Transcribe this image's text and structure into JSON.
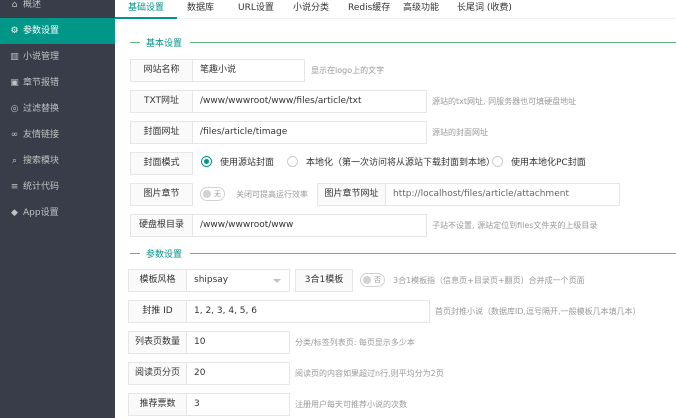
{
  "sidebar": {
    "items": [
      {
        "label": "概述",
        "icon": "home-icon"
      },
      {
        "label": "参数设置",
        "icon": "gear-icon"
      },
      {
        "label": "小说管理",
        "icon": "book-icon"
      },
      {
        "label": "章节报错",
        "icon": "report-icon"
      },
      {
        "label": "过滤替换",
        "icon": "shield-check-icon"
      },
      {
        "label": "友情链接",
        "icon": "link-icon"
      },
      {
        "label": "搜索模块",
        "icon": "search-icon"
      },
      {
        "label": "统计代码",
        "icon": "chart-icon"
      },
      {
        "label": "App设置",
        "icon": "app-icon"
      }
    ]
  },
  "tabs": [
    "基础设置",
    "数据库",
    "URL设置",
    "小说分类",
    "Redis缓存",
    "高级功能",
    "长尾词 (收费)"
  ],
  "basic": {
    "section": "基本设置",
    "site_name": {
      "label": "网站名称",
      "value": "笔趣小说",
      "hint": "显示在logo上的文字"
    },
    "txt_url": {
      "label": "TXT网址",
      "value": "/www/wwwroot/www/files/article/txt",
      "hint": "源站的txt网址, 同服务器也可填硬盘地址"
    },
    "cover_url": {
      "label": "封面网址",
      "value": "/files/article/timage",
      "hint": "源站的封面网址"
    },
    "cover_mode": {
      "label": "封面模式",
      "options": [
        "使用源站封面",
        "本地化（第一次访问将从源站下载封面到本地）",
        "使用本地化PC封面"
      ],
      "selected": 0
    },
    "img_chapter": {
      "label": "图片章节",
      "switch": "无",
      "hint": "关闭可提高运行效率",
      "url_label": "图片章节网址",
      "url_value": "http://localhost/files/article/attachment"
    },
    "disk_root": {
      "label": "硬盘根目录",
      "value": "/www/wwwroot/www",
      "hint": "子站不设置, 源站定位到files文件夹的上级目录"
    }
  },
  "params": {
    "section": "参数设置",
    "template": {
      "label": "模板风格",
      "value": "shipsay",
      "three_in_one_label": "3合1模板",
      "switch": "否",
      "hint": "3合1模板指（信息页+目录页+翻页）合并成一个页面"
    },
    "cover_rec": {
      "label": "封推 ID",
      "value": "1, 2, 3, 4, 5, 6",
      "hint": "首页封推小说（数据库ID,逗号隔开,一般模板几本填几本）"
    },
    "list_count": {
      "label": "列表页数量",
      "value": "10",
      "hint": "分类/标签列表页: 每页显示多少本"
    },
    "read_page": {
      "label": "阅读页分页",
      "value": "20",
      "hint": "阅读页的内容如果超过n行,则平均分为2页"
    },
    "rec_votes": {
      "label": "推荐票数",
      "value": "3",
      "hint": "注册用户每天可推荐小说的次数"
    }
  }
}
